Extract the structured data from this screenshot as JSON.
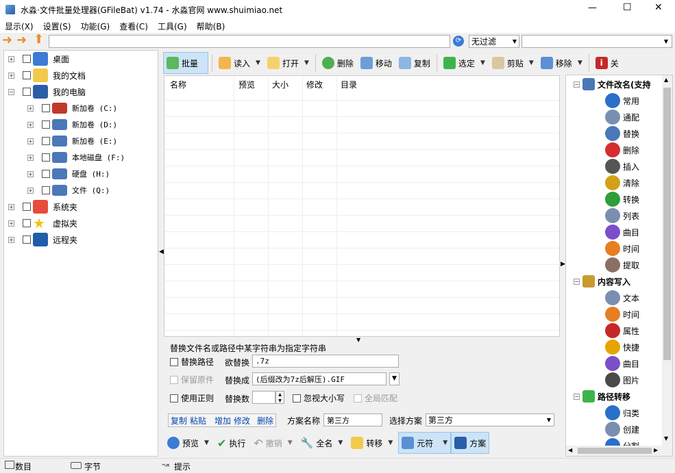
{
  "window": {
    "title": "水淼·文件批量处理器(GFileBat) v1.74 - 水淼官网 www.shuimiao.net",
    "controls": [
      "—",
      "☐",
      "✕"
    ]
  },
  "menu": [
    "显示(X)",
    "设置(S)",
    "功能(G)",
    "查看(C)",
    "工具(G)",
    "帮助(B)"
  ],
  "address": {
    "value": "",
    "filter": "无过滤",
    "filter2": ""
  },
  "tree": {
    "items": [
      {
        "label": "桌面",
        "icon": "desktop-icon",
        "color": "#3a7bd5"
      },
      {
        "label": "我的文档",
        "icon": "folder-icon",
        "color": "#f2c94c"
      },
      {
        "label": "我的电脑",
        "icon": "computer-icon",
        "color": "#2a5ea8"
      },
      {
        "label": "新加卷 (C:)",
        "icon": "drive-icon",
        "color": "#c0392b"
      },
      {
        "label": "新加卷 (D:)",
        "icon": "drive-icon",
        "color": "#4a78b8"
      },
      {
        "label": "新加卷 (E:)",
        "icon": "drive-icon",
        "color": "#4a78b8"
      },
      {
        "label": "本地磁盘 (F:)",
        "icon": "drive-icon",
        "color": "#4a78b8"
      },
      {
        "label": "硬盘 (H:)",
        "icon": "drive-icon",
        "color": "#4a78b8"
      },
      {
        "label": "文件 (Q:)",
        "icon": "drive-icon",
        "color": "#4a78b8"
      },
      {
        "label": "系统夹",
        "icon": "windows-icon",
        "color": "#e74c3c"
      },
      {
        "label": "虚拟夹",
        "icon": "star-icon",
        "color": "#f1c40f"
      },
      {
        "label": "远程夹",
        "icon": "ftp-icon",
        "color": "#1f5fa8"
      }
    ]
  },
  "toolbar": {
    "batch": "批量",
    "read": "读入",
    "open": "打开",
    "delete": "删除",
    "move": "移动",
    "copy": "复制",
    "select": "选定",
    "cut": "剪贴",
    "shift": "移除",
    "close": "关"
  },
  "table": {
    "headers": [
      "名称",
      "预览",
      "大小",
      "修改",
      "目录"
    ]
  },
  "panel": {
    "title": "替换文件名或路径中某字符串为指定字符串",
    "replace_path": "替换路径",
    "want_replace": "欲替换",
    "want_value": ".7z",
    "keep_original": "保留原件",
    "replace_with": "替换成",
    "replace_value": "(后缀改为7z后解压).GIF",
    "use_regex": "使用正则",
    "replace_count": "替换数",
    "ignore_case": "忽视大小写",
    "global_match": "全局匹配"
  },
  "plan": {
    "copy": "复制",
    "paste": "粘贴",
    "add": "增加",
    "edit": "修改",
    "del": "删除",
    "name_label": "方案名称",
    "name_value": "第三方",
    "select_label": "选择方案",
    "select_value": "第三方"
  },
  "bottom": {
    "preview": "预览",
    "execute": "执行",
    "undo": "撤销",
    "fullname": "全名",
    "transfer": "转移",
    "yuanfu": "元符",
    "scheme": "方案"
  },
  "right": {
    "groups": [
      {
        "label": "文件改名(支持",
        "items": [
          "常用",
          "通配",
          "替换",
          "删除",
          "插入",
          "清除",
          "转换",
          "列表",
          "曲目",
          "时间",
          "提取"
        ]
      },
      {
        "label": "内容写入",
        "items": [
          "文本",
          "时间",
          "属性",
          "快捷",
          "曲目",
          "图片"
        ]
      },
      {
        "label": "路径转移",
        "items": [
          "归类",
          "创建",
          "分割"
        ]
      }
    ]
  },
  "status": {
    "count": "数目",
    "bytes": "字节",
    "tip": "提示"
  }
}
